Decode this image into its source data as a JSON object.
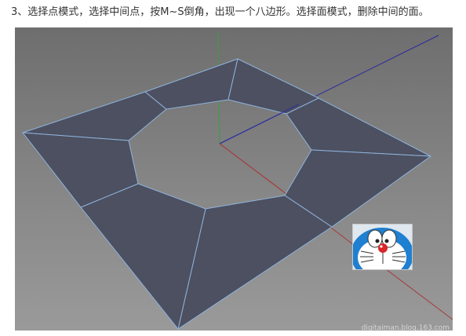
{
  "caption": {
    "text": "3、选择点模式，选择中间点，按M~S倒角，出现一个八边形。选择面模式，删除中间的面。"
  },
  "viewport": {
    "watermark": "digitaiman.blog.163.com",
    "colors": {
      "face": "#4c5060",
      "edge": "#8fb2dc",
      "axis_x": "#a63a3a",
      "axis_y": "#3a9a3a",
      "axis_z": "#2a2a9a"
    }
  },
  "thumbnail": {
    "icon": "doraemon-avatar-icon"
  }
}
